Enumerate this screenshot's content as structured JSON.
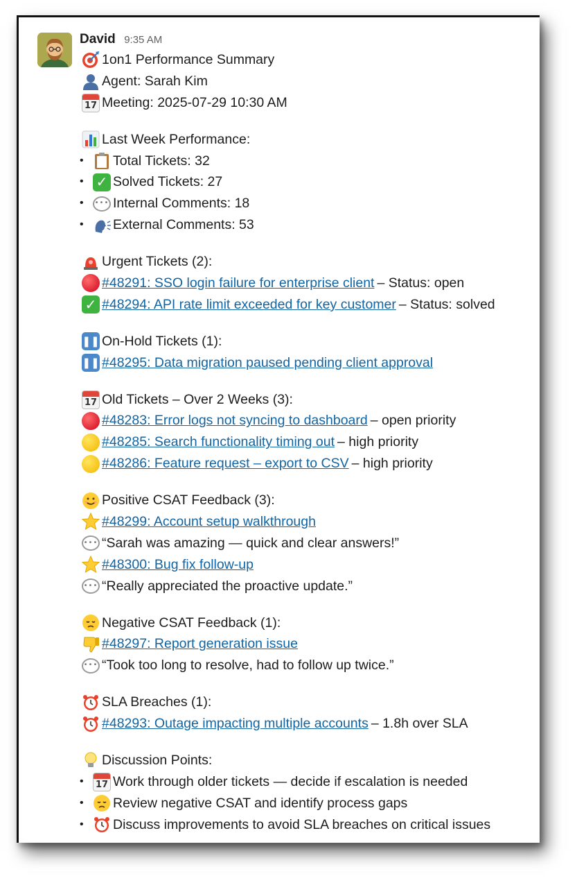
{
  "message": {
    "author": "David",
    "time": "9:35 AM",
    "avatar_icon": "person-avatar"
  },
  "summary": {
    "title": "1on1 Performance Summary",
    "agent": "Agent: Sarah Kim",
    "meeting": "Meeting: 2025-07-29 10:30 AM"
  },
  "performance": {
    "heading": "Last Week Performance:",
    "items": [
      {
        "icon": "clipboard-icon",
        "text": "Total Tickets: 32"
      },
      {
        "icon": "check-mark-icon",
        "text": "Solved Tickets: 27"
      },
      {
        "icon": "speech-bubble-icon",
        "text": "Internal Comments: 18"
      },
      {
        "icon": "speaking-head-icon",
        "text": "External Comments: 53"
      }
    ]
  },
  "urgent": {
    "heading": "Urgent Tickets (2):",
    "items": [
      {
        "icon": "red-circle-icon",
        "link": "#48291: SSO login failure for enterprise client",
        "suffix": "– Status: open"
      },
      {
        "icon": "check-mark-icon",
        "link": "#48294: API rate limit exceeded for key customer",
        "suffix": "– Status: solved"
      }
    ]
  },
  "on_hold": {
    "heading": "On-Hold Tickets (1):",
    "items": [
      {
        "icon": "pause-icon",
        "link": "#48295: Data migration paused pending client approval",
        "suffix": ""
      }
    ]
  },
  "old": {
    "heading": "Old Tickets – Over 2 Weeks (3):",
    "items": [
      {
        "icon": "red-circle-icon",
        "link": "#48283: Error logs not syncing to dashboard",
        "suffix": "– open priority"
      },
      {
        "icon": "yellow-circle-icon",
        "link": "#48285: Search functionality timing out",
        "suffix": "– high priority"
      },
      {
        "icon": "yellow-circle-icon",
        "link": "#48286: Feature request – export to CSV",
        "suffix": "– high priority"
      }
    ]
  },
  "positive": {
    "heading": "Positive CSAT Feedback (3):",
    "link1": "#48299: Account setup walkthrough",
    "quote1": "“Sarah was amazing — quick and clear answers!”",
    "link2": "#48300: Bug fix follow-up",
    "quote2": "“Really appreciated the proactive update.”"
  },
  "negative": {
    "heading": "Negative CSAT Feedback (1):",
    "link1": "#48297: Report generation issue",
    "quote1": "“Took too long to resolve, had to follow up twice.”"
  },
  "sla": {
    "heading": "SLA Breaches (1):",
    "link1": "#48293: Outage impacting multiple accounts",
    "suffix1": "– 1.8h over SLA"
  },
  "discussion": {
    "heading": "Discussion Points:",
    "items": [
      "Work through older tickets — decide if escalation is needed",
      "Review negative CSAT and identify process gaps",
      "Discuss improvements to avoid SLA breaches on critical issues"
    ]
  }
}
